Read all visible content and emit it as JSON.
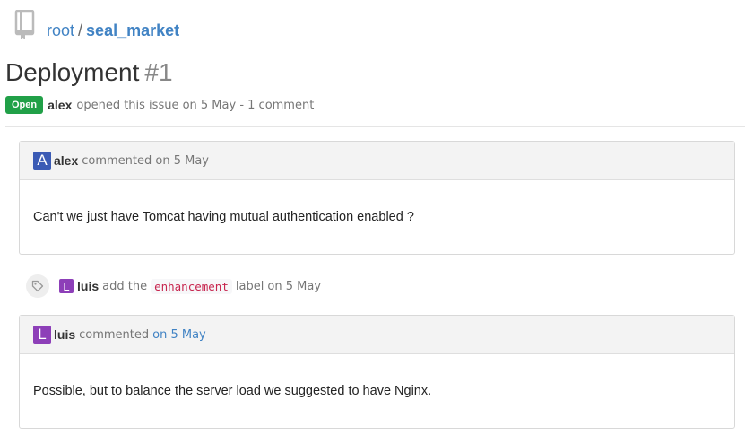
{
  "breadcrumb": {
    "owner": "root",
    "separator": "/",
    "repo": "seal_market"
  },
  "issue": {
    "title": "Deployment",
    "number": "#1",
    "status": "Open",
    "author": "alex",
    "opened_text": "opened this issue on 5 May - 1 comment"
  },
  "comments": [
    {
      "avatar_letter": "A",
      "avatar_color": "#3b5bb5",
      "author": "alex",
      "action": "commented on 5 May",
      "body": "Can't we just have Tomcat having mutual authentication enabled ?"
    },
    {
      "avatar_letter": "L",
      "avatar_color": "#8d3fb8",
      "author": "luis",
      "action": "commented",
      "date_link": "on 5 May",
      "body": "Possible, but to balance the server load we suggested to have Nginx."
    }
  ],
  "event": {
    "icon": "tag-icon",
    "avatar_letter": "L",
    "avatar_color": "#8d3fb8",
    "author": "luis",
    "prefix": "add the",
    "label": "enhancement",
    "suffix": "label on 5 May"
  },
  "colors": {
    "link": "#4183c4",
    "open_badge": "#21a048",
    "label_text": "#c7254e"
  }
}
